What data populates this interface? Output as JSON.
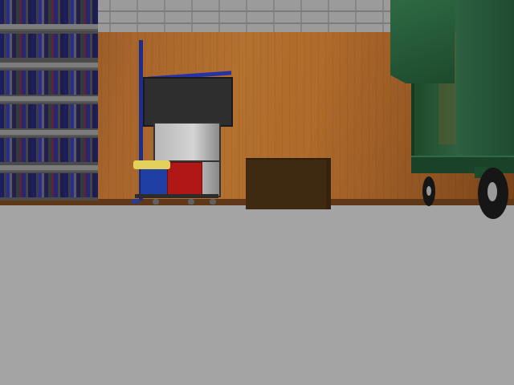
{
  "scene": {
    "name": "warehouse-room-first-person-view",
    "objects": [
      "bookshelf",
      "janitor-cart",
      "brown-crate",
      "green-dumpster"
    ]
  },
  "colors": {
    "floor": "#a4a4a4",
    "wall_wood": "#b06a2b",
    "wall_brick": "#9b9b9b",
    "cart_blue": "#1f3fa5",
    "cart_red": "#b01818",
    "cloth_yellow": "#e2d25c",
    "crate": "#3e2a10",
    "dumpster_green": "#2d6040"
  },
  "icons": {
    "shelf": "bookshelf-icon",
    "cart": "janitor-cart-icon",
    "crate": "crate-icon",
    "dumpster": "dumpster-icon"
  }
}
